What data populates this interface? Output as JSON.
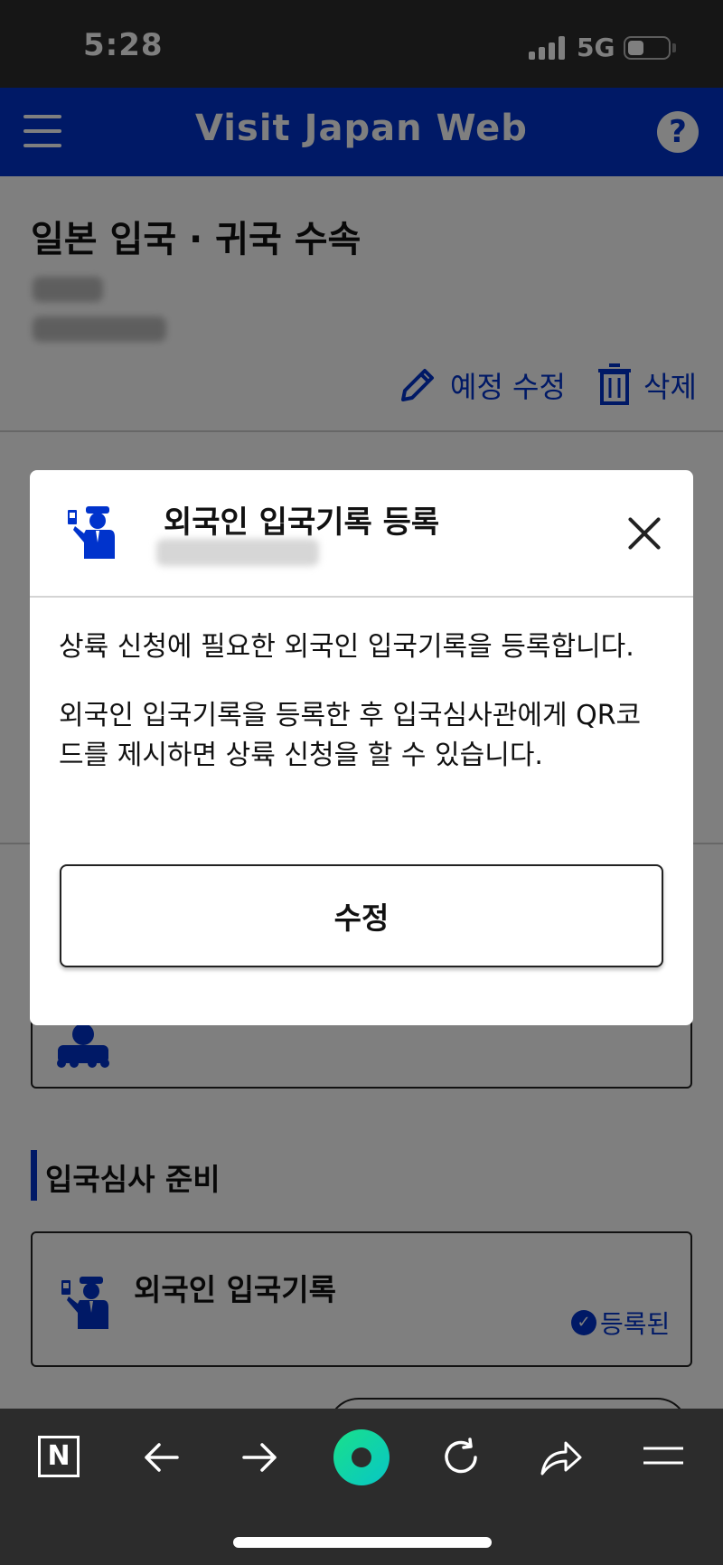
{
  "status_bar": {
    "time": "5:28",
    "network": "5G",
    "battery_level": 0.4
  },
  "app_header": {
    "title": "Visit Japan Web",
    "menu_icon": "hamburger-icon",
    "help_icon": "question-icon",
    "help_label": "?",
    "color": "#0033cc"
  },
  "page": {
    "title": "일본 입국 · 귀국 수속",
    "actions": {
      "edit_label": "예정 수정",
      "delete_label": "삭제"
    },
    "section_title": "입국심사 준비",
    "card": {
      "title": "외국인 입국기록",
      "status": "등록된",
      "status_icon": "check-circle-icon"
    }
  },
  "modal": {
    "title": "외국인 입국기록 등록",
    "paragraph_1": "상륙 신청에 필요한 외국인 입국기록을 등록합니다.",
    "paragraph_2": "외국인 입국기록을 등록한 후 입국심사관에게 QR코드를 제시하면 상륙 신청을 할 수 있습니다.",
    "button_label": "수정",
    "icon": "immigration-officer-icon",
    "close_icon": "close-icon"
  },
  "browser_bar": {
    "icons": [
      "naver-n-icon",
      "back-arrow-icon",
      "forward-arrow-icon",
      "green-dot-icon",
      "reload-icon",
      "share-icon",
      "menu-icon"
    ],
    "n_label": "N"
  }
}
